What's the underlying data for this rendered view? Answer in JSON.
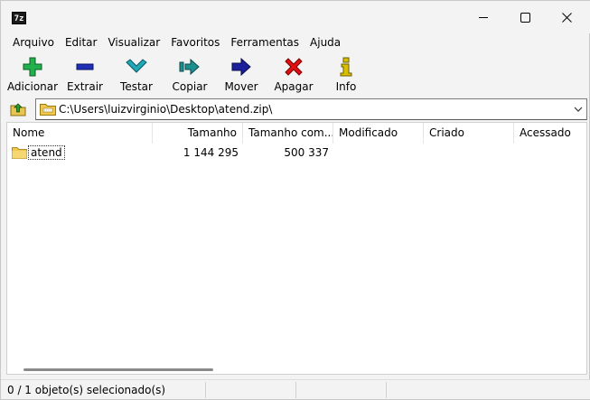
{
  "window": {
    "app_icon_text": "7z",
    "controls": [
      "minimize-icon",
      "maximize-icon",
      "close-icon"
    ]
  },
  "menu": [
    "Arquivo",
    "Editar",
    "Visualizar",
    "Favoritos",
    "Ferramentas",
    "Ajuda"
  ],
  "toolbar": [
    {
      "label": "Adicionar",
      "icon": "plus-icon",
      "color": "#22b14c"
    },
    {
      "label": "Extrair",
      "icon": "minus-icon",
      "color": "#1f2fb8"
    },
    {
      "label": "Testar",
      "icon": "check-icon",
      "color": "#20a8b8"
    },
    {
      "label": "Copiar",
      "icon": "copy-arrow-icon",
      "color": "#1d8f8f"
    },
    {
      "label": "Mover",
      "icon": "move-arrow-icon",
      "color": "#1a1f9a"
    },
    {
      "label": "Apagar",
      "icon": "delete-x-icon",
      "color": "#e01010"
    },
    {
      "label": "Info",
      "icon": "info-icon",
      "color": "#d8c000"
    }
  ],
  "address": {
    "path": "C:\\Users\\luizvirginio\\Desktop\\atend.zip\\"
  },
  "columns": [
    "Nome",
    "Tamanho",
    "Tamanho com...",
    "Modificado",
    "Criado",
    "Acessado"
  ],
  "rows": [
    {
      "name": "atend",
      "size": "1 144 295",
      "packed": "500 337",
      "modified": "",
      "created": "",
      "accessed": ""
    }
  ],
  "status": {
    "text": "0 / 1 objeto(s) selecionado(s)"
  }
}
